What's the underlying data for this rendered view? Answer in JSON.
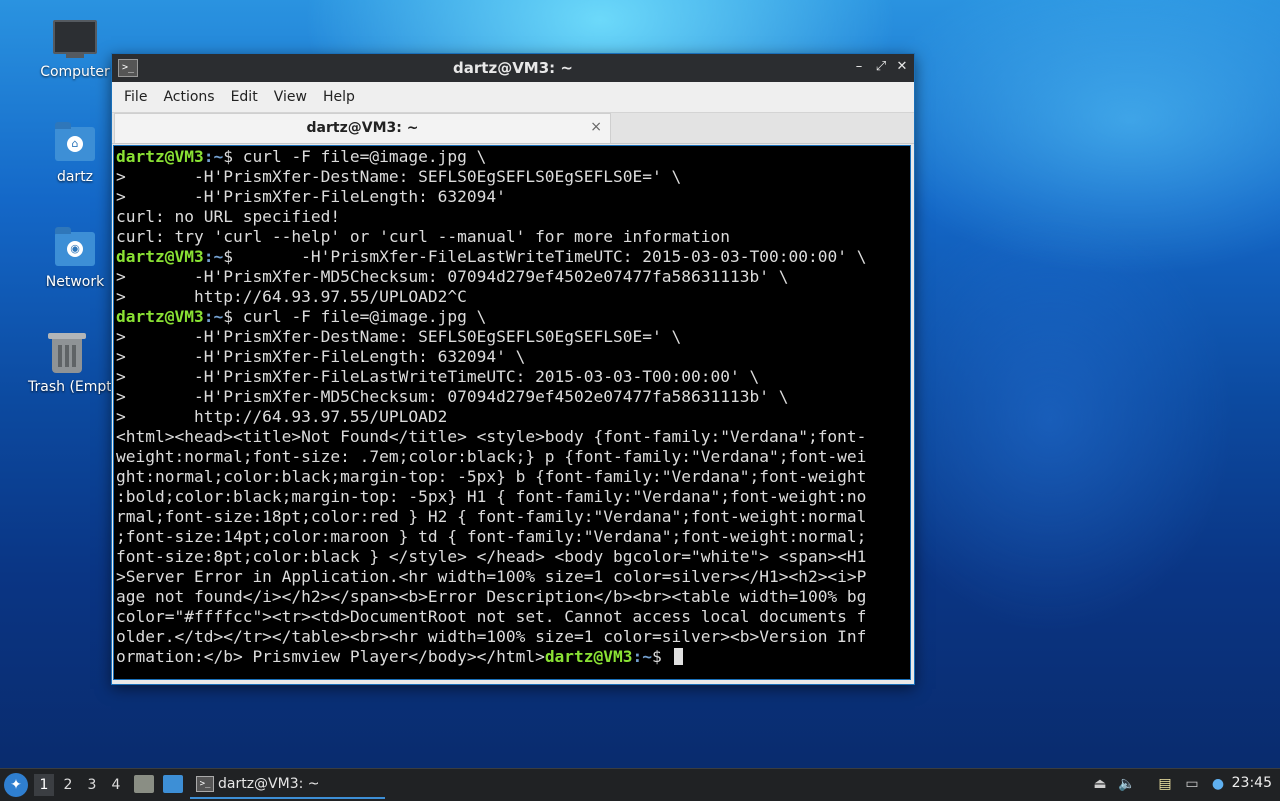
{
  "desktop": {
    "icons": [
      {
        "label": "Computer",
        "icon": "computer-icon"
      },
      {
        "label": "dartz",
        "icon": "home-folder-icon"
      },
      {
        "label": "Network",
        "icon": "network-folder-icon"
      },
      {
        "label": "Trash (Empty)",
        "icon": "trash-icon"
      }
    ]
  },
  "window": {
    "title": "dartz@VM3: ~",
    "menu": [
      "File",
      "Actions",
      "Edit",
      "View",
      "Help"
    ],
    "tab_label": "dartz@VM3: ~",
    "tab_close": "×",
    "buttons": {
      "minimize": "–",
      "maximize": "⤢",
      "close": "✕"
    }
  },
  "terminal": {
    "prompt_user": "dartz@VM3",
    "prompt_path": ":~",
    "lines": [
      {
        "prompt": true,
        "text": "$ curl -F file=@image.jpg \\"
      },
      {
        "prompt": false,
        "text": ">       -H'PrismXfer-DestName: SEFLS0EgSEFLS0EgSEFLS0E=' \\"
      },
      {
        "prompt": false,
        "text": ">       -H'PrismXfer-FileLength: 632094'"
      },
      {
        "prompt": false,
        "text": "curl: no URL specified!"
      },
      {
        "prompt": false,
        "text": "curl: try 'curl --help' or 'curl --manual' for more information"
      },
      {
        "prompt": true,
        "text": "$       -H'PrismXfer-FileLastWriteTimeUTC: 2015-03-03-T00:00:00' \\"
      },
      {
        "prompt": false,
        "text": ">       -H'PrismXfer-MD5Checksum: 07094d279ef4502e07477fa58631113b' \\"
      },
      {
        "prompt": false,
        "text": ">       http://64.93.97.55/UPLOAD2^C"
      },
      {
        "prompt": true,
        "text": "$ curl -F file=@image.jpg \\"
      },
      {
        "prompt": false,
        "text": ">       -H'PrismXfer-DestName: SEFLS0EgSEFLS0EgSEFLS0E=' \\"
      },
      {
        "prompt": false,
        "text": ">       -H'PrismXfer-FileLength: 632094' \\"
      },
      {
        "prompt": false,
        "text": ">       -H'PrismXfer-FileLastWriteTimeUTC: 2015-03-03-T00:00:00' \\"
      },
      {
        "prompt": false,
        "text": ">       -H'PrismXfer-MD5Checksum: 07094d279ef4502e07477fa58631113b' \\"
      },
      {
        "prompt": false,
        "text": ">       http://64.93.97.55/UPLOAD2"
      },
      {
        "prompt": false,
        "text": "<html><head><title>Not Found</title> <style>body {font-family:\"Verdana\";font-"
      },
      {
        "prompt": false,
        "text": "weight:normal;font-size: .7em;color:black;} p {font-family:\"Verdana\";font-wei"
      },
      {
        "prompt": false,
        "text": "ght:normal;color:black;margin-top: -5px} b {font-family:\"Verdana\";font-weight"
      },
      {
        "prompt": false,
        "text": ":bold;color:black;margin-top: -5px} H1 { font-family:\"Verdana\";font-weight:no"
      },
      {
        "prompt": false,
        "text": "rmal;font-size:18pt;color:red } H2 { font-family:\"Verdana\";font-weight:normal"
      },
      {
        "prompt": false,
        "text": ";font-size:14pt;color:maroon } td { font-family:\"Verdana\";font-weight:normal;"
      },
      {
        "prompt": false,
        "text": "font-size:8pt;color:black } </style> </head> <body bgcolor=\"white\"> <span><H1"
      },
      {
        "prompt": false,
        "text": ">Server Error in Application.<hr width=100% size=1 color=silver></H1><h2><i>P"
      },
      {
        "prompt": false,
        "text": "age not found</i></h2></span><b>Error Description</b><br><table width=100% bg"
      },
      {
        "prompt": false,
        "text": "color=\"#ffffcc\"><tr><td>DocumentRoot not set. Cannot access local documents f"
      },
      {
        "prompt": false,
        "text": "older.</td></tr></table><br><hr width=100% size=1 color=silver><b>Version Inf"
      }
    ],
    "last_line_text": "ormation:</b> Prismview Player</body></html>",
    "last_prompt_suffix": "$ "
  },
  "taskbar": {
    "workspaces": [
      "1",
      "2",
      "3",
      "4"
    ],
    "active_workspace": "1",
    "task_label": "dartz@VM3: ~",
    "clock": "23:45"
  }
}
